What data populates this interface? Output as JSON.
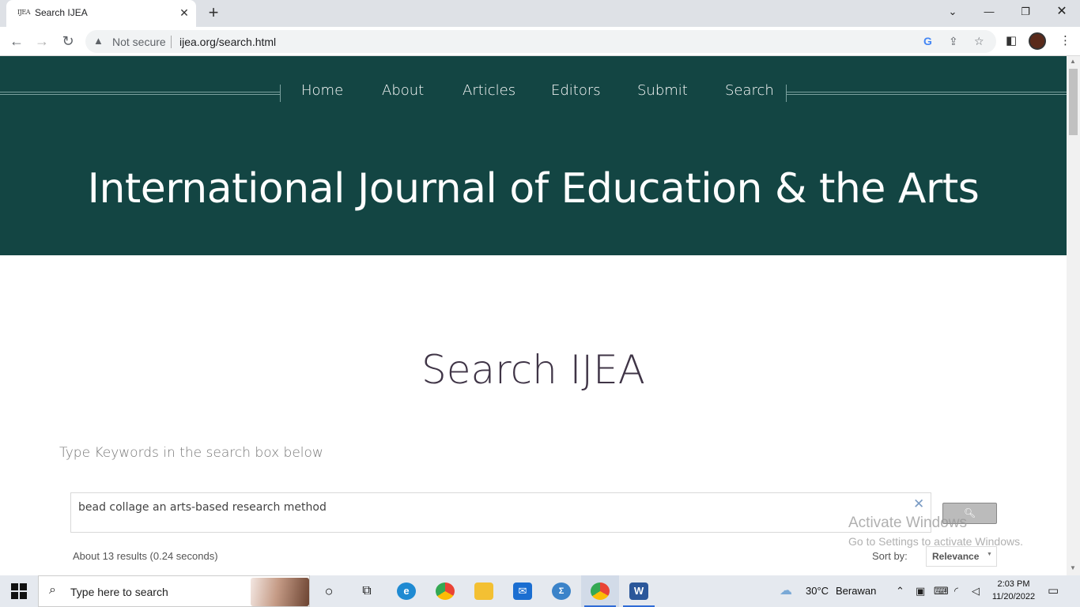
{
  "browser": {
    "tab": {
      "favicon_text": "IJEA",
      "title": "Search IJEA"
    },
    "address": {
      "security_label": "Not secure",
      "url": "ijea.org/search.html"
    }
  },
  "site": {
    "nav": [
      "Home",
      "About",
      "Articles",
      "Editors",
      "Submit",
      "Search"
    ],
    "title": "International Journal of Education & the Arts"
  },
  "search_page": {
    "heading": "Search IJEA",
    "instructions": "Type Keywords in the search box below",
    "query": "bead collage an arts-based research method",
    "results_count": "About 13 results (0.24 seconds)",
    "sort_label": "Sort by:",
    "sort_value": "Relevance"
  },
  "watermark": {
    "line1": "Activate Windows",
    "line2": "Go to Settings to activate Windows."
  },
  "taskbar": {
    "search_placeholder": "Type here to search",
    "weather": {
      "temp": "30°C",
      "condition": "Berawan"
    },
    "clock": {
      "time": "2:03 PM",
      "date": "11/20/2022"
    }
  },
  "colors": {
    "hero_bg": "#134543",
    "heading": "#3f3446",
    "tabstrip": "#dee1e6"
  }
}
